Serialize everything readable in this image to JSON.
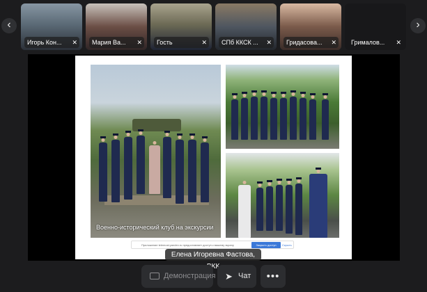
{
  "participants": [
    {
      "name": "Игорь Кон...",
      "bg": "#5b6a76"
    },
    {
      "name": "Мария Ва...",
      "bg": "#5c4a44"
    },
    {
      "name": "Гость",
      "bg": "#6c6a55"
    },
    {
      "name": "СПб ККСК ...",
      "bg": "#4e5660"
    },
    {
      "name": "Гридасова...",
      "bg": "#7a5a4a"
    },
    {
      "name": "Грималов...",
      "bg": "#18181a"
    }
  ],
  "slide": {
    "caption": "Военно-исторический клуб на экскурсии",
    "share_bar": {
      "message": "Приложение telemost.yandex.ru предоставляет доступ к вашему экрану",
      "open_label": "Закрыть доступ",
      "hide_label": "Скрыть"
    }
  },
  "speaker": "Елена Игоревна Фастова, ВКК",
  "toolbar": {
    "demo_label": "Демонстрация",
    "chat_label": "Чат",
    "more_label": "•••"
  },
  "icons": {
    "left": "‹",
    "right": "›",
    "mic_off": "🎙",
    "chat": "➤"
  }
}
